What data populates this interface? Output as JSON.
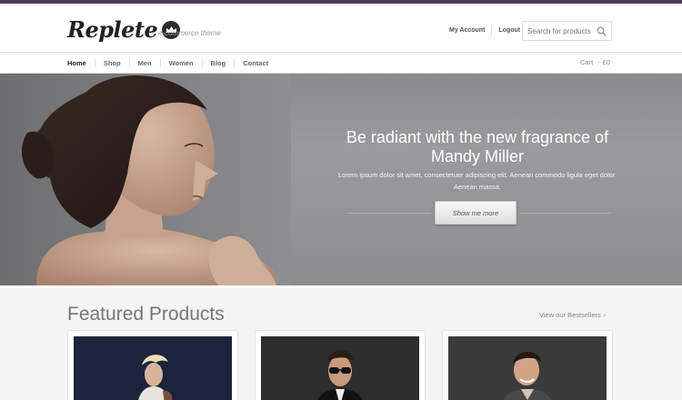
{
  "header": {
    "logo_text": "Replete",
    "tagline": "e-commerce theme",
    "my_account": "My Account",
    "logout": "Logout",
    "search_placeholder": "Search for products"
  },
  "nav": {
    "items": [
      {
        "label": "Home",
        "active": true
      },
      {
        "label": "Shop"
      },
      {
        "label": "Men"
      },
      {
        "label": "Women"
      },
      {
        "label": "Blog"
      },
      {
        "label": "Contact"
      }
    ],
    "cart_label": "Cart",
    "cart_sep": "-",
    "cart_count": "£0"
  },
  "hero": {
    "title": "Be radiant with the new fragrance of Mandy Miller",
    "text": "Lorem ipsum dolor sit amet, consectetuer adipiscing elit. Aenean commodo ligula eget dolor. Aenean massa.",
    "button": "Show me more"
  },
  "featured": {
    "title": "Featured Products",
    "link": "View our Bestsellers",
    "link_chevron": "›"
  },
  "colors": {
    "top_bar": "#4b3a5a",
    "hero_bg": "#9b9b9e"
  },
  "icons": [
    "crown-icon",
    "search-icon",
    "cart-icon",
    "chevron-right-icon"
  ]
}
